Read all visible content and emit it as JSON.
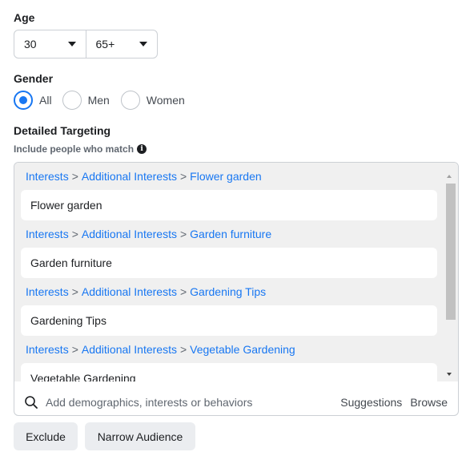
{
  "age": {
    "label": "Age",
    "min_value": "30",
    "max_value": "65+"
  },
  "gender": {
    "label": "Gender",
    "options": [
      {
        "label": "All",
        "selected": true
      },
      {
        "label": "Men",
        "selected": false
      },
      {
        "label": "Women",
        "selected": false
      }
    ]
  },
  "targeting": {
    "label": "Detailed Targeting",
    "include_label": "Include people who match",
    "groups": [
      {
        "path": [
          "Interests",
          "Additional Interests",
          "Flower garden"
        ],
        "item": "Flower garden"
      },
      {
        "path": [
          "Interests",
          "Additional Interests",
          "Garden furniture"
        ],
        "item": "Garden furniture"
      },
      {
        "path": [
          "Interests",
          "Additional Interests",
          "Gardening Tips"
        ],
        "item": "Gardening Tips"
      },
      {
        "path": [
          "Interests",
          "Additional Interests",
          "Vegetable Gardening"
        ],
        "item": "Vegetable Gardening"
      }
    ],
    "search_placeholder": "Add demographics, interests or behaviors",
    "suggestions_label": "Suggestions",
    "browse_label": "Browse"
  },
  "buttons": {
    "exclude": "Exclude",
    "narrow": "Narrow Audience"
  },
  "colors": {
    "accent": "#1877f2",
    "list_background": "#f0f0f0",
    "button_background": "#ebedf0"
  }
}
